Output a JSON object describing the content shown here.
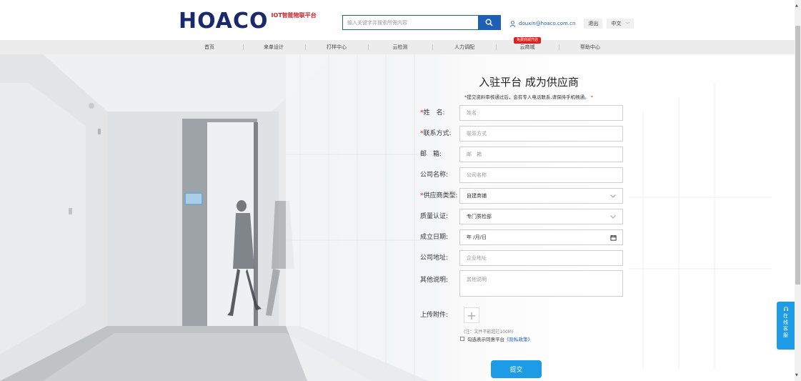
{
  "header": {
    "logo_text": "HOACO",
    "logo_sup": "IOT智能物联平台",
    "search_placeholder": "输入关键字并搜索所需内容",
    "user_email": "douxin@hoaco.com.cn",
    "logout_label": "退出",
    "language": "中文"
  },
  "nav": {
    "items": [
      {
        "label": "首页"
      },
      {
        "label": "来单设计"
      },
      {
        "label": "打样中心"
      },
      {
        "label": "云检测"
      },
      {
        "label": "人力调配"
      },
      {
        "label": "云商城"
      },
      {
        "label": "帮助中心"
      }
    ],
    "badge": "免费商城开店"
  },
  "form": {
    "title": "入驻平台 成为供应商",
    "note": "*提交资料审核通过后，会有专人电话联系,请保持手机畅通。",
    "note_star": "*",
    "fields": {
      "name": {
        "label": "姓　名:",
        "placeholder": "姓名"
      },
      "contact": {
        "label": "联系方式:",
        "placeholder": "联系方式"
      },
      "email": {
        "label": "邮　箱:",
        "placeholder": "邮　箱"
      },
      "company": {
        "label": "公司名称:",
        "placeholder": "公司名称"
      },
      "supplier_type": {
        "label": "供应商类型:",
        "value": "自建商铺"
      },
      "certification": {
        "label": "质量认证:",
        "value": "专门质检部"
      },
      "founded_date": {
        "label": "成立日期:",
        "value": "年 /月/日"
      },
      "address": {
        "label": "公司地址:",
        "placeholder": "企业地址"
      },
      "other": {
        "label": "其他说明:",
        "placeholder": "其他说明"
      }
    },
    "required_mark": "*",
    "upload_label": "上传附件:",
    "upload_plus": "+",
    "upload_note": "(注：文件不能超过100M)",
    "agree_text": "勾选表示同意平台",
    "policy_text": "《隐私政策》",
    "submit_label": "提交"
  },
  "service": {
    "label": "在线客服"
  },
  "colors": {
    "brand_blue": "#1f5fb8",
    "accent_blue": "#1e9be6",
    "required_red": "#e02020",
    "logo_navy": "#1a2a6c"
  }
}
